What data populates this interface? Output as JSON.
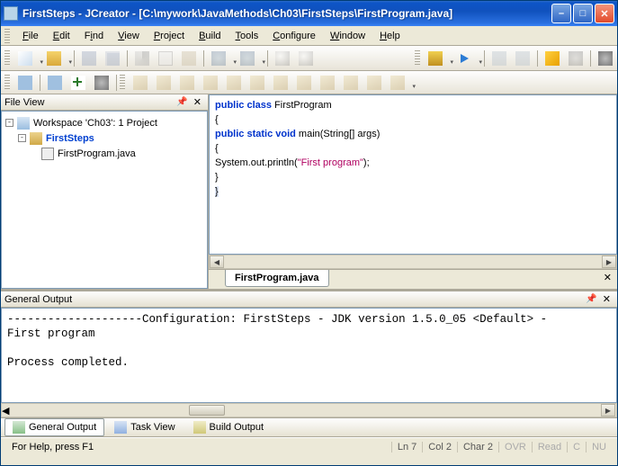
{
  "title": "FirstSteps - JCreator - [C:\\mywork\\JavaMethods\\Ch03\\FirstSteps\\FirstProgram.java]",
  "menus": {
    "file": "File",
    "edit": "Edit",
    "find": "Find",
    "view": "View",
    "project": "Project",
    "build": "Build",
    "tools": "Tools",
    "configure": "Configure",
    "window": "Window",
    "help": "Help"
  },
  "file_view": {
    "title": "File View",
    "workspace": "Workspace 'Ch03': 1 Project",
    "project": "FirstSteps",
    "file": "FirstProgram.java"
  },
  "editor_tab": "FirstProgram.java",
  "code": {
    "l1a": "public",
    "l1b": " class",
    "l1c": " FirstProgram",
    "l2": "{",
    "l3a": "  public",
    "l3b": " static",
    "l3c": " void",
    "l3d": " main(String[] args)",
    "l4": "  {",
    "l5a": "    System.out.println(",
    "l5b": "\"First program\"",
    "l5c": ");",
    "l6": "  }",
    "l7": "}"
  },
  "output": {
    "title": "General Output",
    "body": "--------------------Configuration: FirstSteps - JDK version 1.5.0_05 <Default> -\nFirst program\n\nProcess completed."
  },
  "bottom_tabs": {
    "general": "General Output",
    "task": "Task View",
    "build": "Build Output"
  },
  "status": {
    "help": "For Help, press F1",
    "ln": "Ln 7",
    "col": "Col 2",
    "char": "Char 2",
    "ovr": "OVR",
    "read": "Read",
    "cap": "C",
    "num": "NU"
  }
}
